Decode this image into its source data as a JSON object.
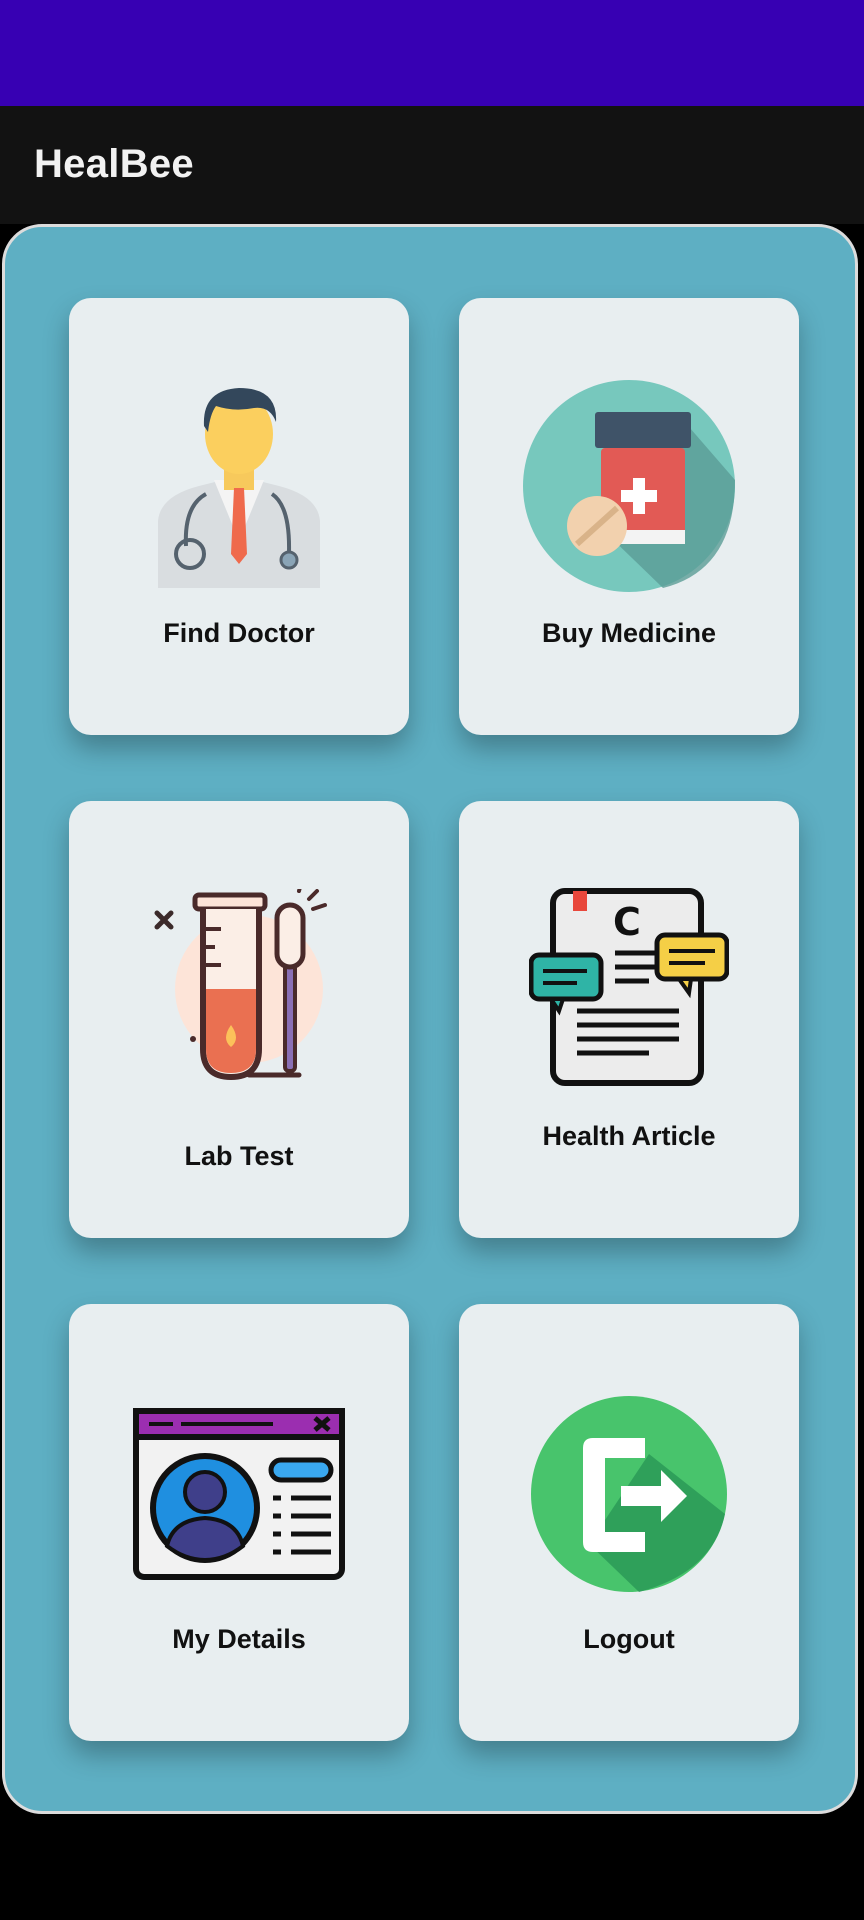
{
  "app": {
    "title": "HealBee"
  },
  "menu": {
    "find_doctor": {
      "label": "Find Doctor",
      "icon": "doctor-icon"
    },
    "buy_medicine": {
      "label": "Buy Medicine",
      "icon": "medicine-bottle-icon"
    },
    "lab_test": {
      "label": "Lab Test",
      "icon": "test-tube-icon"
    },
    "health_article": {
      "label": "Health Article",
      "icon": "article-icon"
    },
    "my_details": {
      "label": "My Details",
      "icon": "profile-window-icon"
    },
    "logout": {
      "label": "Logout",
      "icon": "logout-icon"
    }
  },
  "colors": {
    "status_bar": "#3700b3",
    "app_bar": "#121212",
    "panel": "#5eafc3",
    "card": "#e8eef0"
  }
}
